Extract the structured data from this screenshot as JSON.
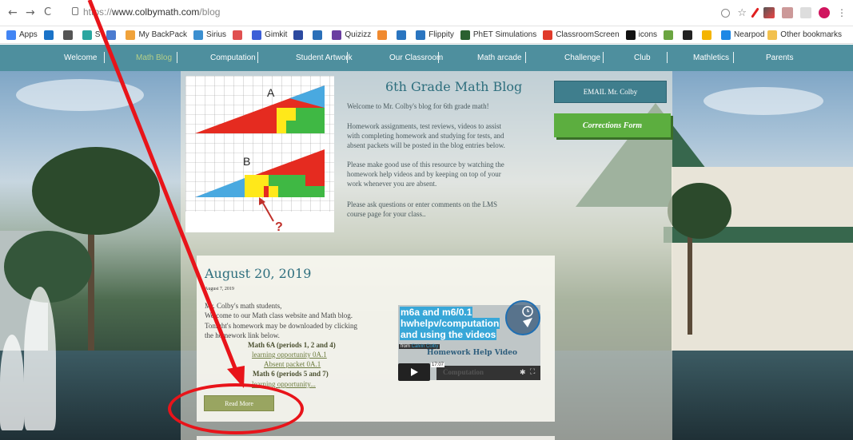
{
  "browser": {
    "url_scheme": "https://",
    "url_host": "www.colbymath.com",
    "url_path": "/blog",
    "bookmarks": [
      {
        "label": "Apps",
        "color": "#4285f4"
      },
      {
        "label": "",
        "color": "#1a73c8"
      },
      {
        "label": "",
        "color": "#555555"
      },
      {
        "label": "S",
        "color": "#2aa6a0"
      },
      {
        "label": "",
        "color": "#4a7bd0"
      },
      {
        "label": "My BackPack",
        "color": "#f0a23a"
      },
      {
        "label": "Sirius",
        "color": "#3b8fd0"
      },
      {
        "label": "",
        "color": "#e05050"
      },
      {
        "label": "Gimkit",
        "color": "#3c5fd7"
      },
      {
        "label": "",
        "color": "#2c4aa0"
      },
      {
        "label": "",
        "color": "#2a6fb8"
      },
      {
        "label": "Quizizz",
        "color": "#6a3ea0"
      },
      {
        "label": "",
        "color": "#f08a30"
      },
      {
        "label": "",
        "color": "#2a75c0"
      },
      {
        "label": "Flippity",
        "color": "#2a75c0"
      },
      {
        "label": "PhET Simulations",
        "color": "#2a6030"
      },
      {
        "label": "ClassroomScreen",
        "color": "#e03a2a"
      },
      {
        "label": "icons",
        "color": "#111111"
      },
      {
        "label": "",
        "color": "#6ba541"
      },
      {
        "label": "",
        "color": "#222222"
      },
      {
        "label": "",
        "color": "#f4b400"
      },
      {
        "label": "Nearpod",
        "color": "#1e88e5"
      }
    ],
    "other_bookmarks": "Other bookmarks"
  },
  "nav": {
    "items": [
      "Welcome",
      "Math Blog",
      "Computation",
      "Student Artwork",
      "Our Classroom",
      "Math arcade",
      "Challenge",
      "Club",
      "Mathletics",
      "Parents"
    ],
    "active": "Math Blog"
  },
  "header": {
    "title": "6th Grade Math Blog",
    "intro": "Welcome to Mr. Colby's blog for 6th grade math!",
    "para1": [
      "Homework assignments, test reviews, videos to assist",
      "with completing homework and studying for tests, and",
      "absent packets will be posted in the blog entries below."
    ],
    "para2": [
      "Please make good use of this resource by watching the",
      "homework help videos and by keeping on top of your",
      "work whenever you are absent."
    ],
    "para3": [
      "Please ask questions or enter comments on the LMS",
      "course page for your class.."
    ],
    "email_button": "EMAIL Mr. Colby",
    "corrections_button": "Corrections Form"
  },
  "graphic": {
    "label_a": "A",
    "label_b": "B",
    "question": "?"
  },
  "post": {
    "title": "August 20, 2019",
    "date": "August 7, 2019",
    "lines": [
      "Mr. Colby's math students,",
      "Welcome to our Math class website and Math blog.",
      "Tonight's homework may be downloaded by clicking",
      "the homework link below."
    ],
    "math6a": "Math 6A (periods 1, 2 and 4)",
    "link1": "learning opportunity 0A.1",
    "link2": "Absent packet 0A.1",
    "math6": "Math 6 (periods 5 and 7)",
    "link3": "learning opportunity...",
    "read_more": "Read More"
  },
  "video": {
    "title_lines": [
      "m6a and m6/0.1",
      "hwhelpv/computation",
      "and using the videos"
    ],
    "from_label": "from",
    "author": "Calvin Colby",
    "caption": "Homework Help Video",
    "time": "17:07",
    "bar_label": "Computation"
  },
  "colors": {
    "nav": "#4e8f9e",
    "title": "#2d6e7d",
    "annotation": "#e8141a"
  }
}
